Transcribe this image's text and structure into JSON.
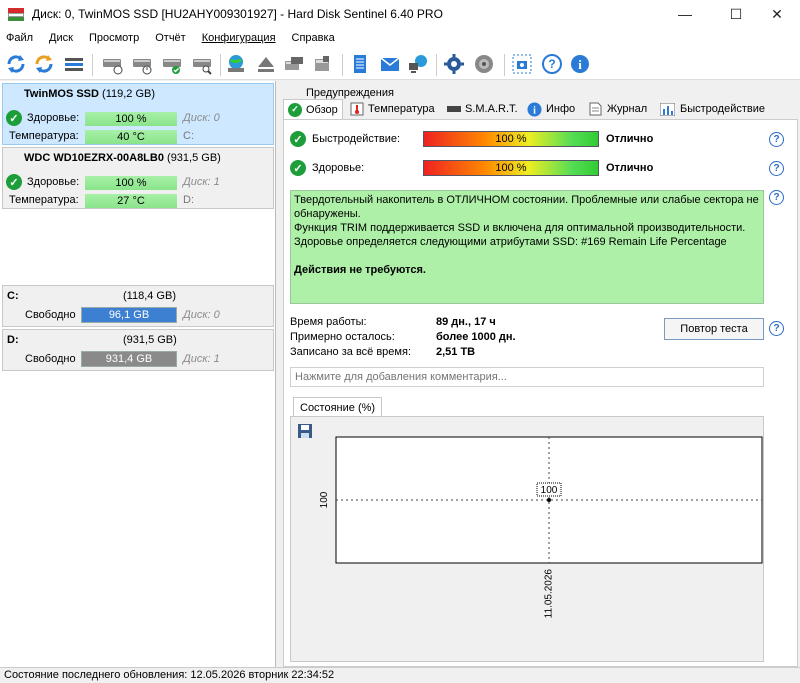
{
  "window": {
    "title": "Диск: 0, TwinMOS SSD [HU2AHY009301927]  -  Hard Disk Sentinel 6.40 PRO",
    "minimize": "—",
    "maximize": "☐",
    "close": "✕"
  },
  "menu": [
    "Файл",
    "Диск",
    "Просмотр",
    "Отчёт",
    "Конфигурация",
    "Справка"
  ],
  "toolbar": {
    "icons": [
      "refresh-icon",
      "refresh-all-icon",
      "disk-list-icon",
      "disk-info-icon",
      "disk-schedule-icon",
      "disk-ok-icon",
      "disk-search-icon",
      "globe-disk-icon",
      "eject-icon",
      "disk-export-icon",
      "disk-test-icon",
      "notes-icon",
      "email-icon",
      "network-icon",
      "settings-icon",
      "sound-icon",
      "screenshot-icon",
      "help-icon",
      "info-icon"
    ]
  },
  "disks": [
    {
      "name": "TwinMOS SSD",
      "size": "(119,2 GB)",
      "health_label": "Здоровье:",
      "health_value": "100 %",
      "health_fraction": 1.0,
      "disk_ref": "Диск: 0",
      "temp_label": "Температура:",
      "temp_value": "40 °C",
      "temp_ref": "C:"
    },
    {
      "name": "WDC WD10EZRX-00A8LB0",
      "size": "(931,5 GB)",
      "health_label": "Здоровье:",
      "health_value": "100 %",
      "health_fraction": 1.0,
      "disk_ref": "Диск: 1",
      "temp_label": "Температура:",
      "temp_value": "27 °C",
      "temp_ref": "D:"
    }
  ],
  "volumes": [
    {
      "letter": "C:",
      "size": "(118,4 GB)",
      "free_label": "Свободно",
      "free_value": "96,1 GB",
      "free_fraction": 1.0,
      "color": "#3d7fd0",
      "disk_ref": "Диск: 0"
    },
    {
      "letter": "D:",
      "size": "(931,5 GB)",
      "free_label": "Свободно",
      "free_value": "931,4 GB",
      "free_fraction": 1.0,
      "color": "#8a8a8a",
      "disk_ref": "Диск: 1"
    }
  ],
  "tabs": {
    "warnings": "Предупреждения",
    "overview": "Обзор",
    "temperature": "Температура",
    "smart": "S.M.A.R.T.",
    "info": "Инфо",
    "log": "Журнал",
    "performance": "Быстродействие"
  },
  "overview": {
    "performance_label": "Быстродействие:",
    "performance_value": "100 %",
    "performance_status": "Отлично",
    "health_label": "Здоровье:",
    "health_value": "100 %",
    "health_status": "Отлично",
    "message_lines": [
      "Твердотельный накопитель в ОТЛИЧНОМ состоянии. Проблемные или слабые сектора не обнаружены.",
      "Функция TRIM поддерживается SSD и включена для оптимальной производительности.",
      "Здоровье определяется следующими атрибутами SSD: #169 Remain Life Percentage"
    ],
    "message_action": "Действия не требуются.",
    "uptime_label": "Время работы:",
    "uptime_value": "89 дн., 17 ч",
    "remaining_label": "Примерно осталось:",
    "remaining_value": "более 1000 дн.",
    "written_label": "Записано за всё время:",
    "written_value": "2,51 TB",
    "retest_button": "Повтор теста",
    "comment_placeholder": "Нажмите для добавления комментария..."
  },
  "chart_tab": "Состояние (%)",
  "chart_data": {
    "type": "line",
    "x": [
      "11.05.2026"
    ],
    "series": [
      {
        "values": [
          100
        ]
      }
    ],
    "y_tick_label": "100",
    "data_label": "100"
  },
  "statusbar": "Состояние последнего обновления: 12.05.2026 вторник 22:34:52"
}
